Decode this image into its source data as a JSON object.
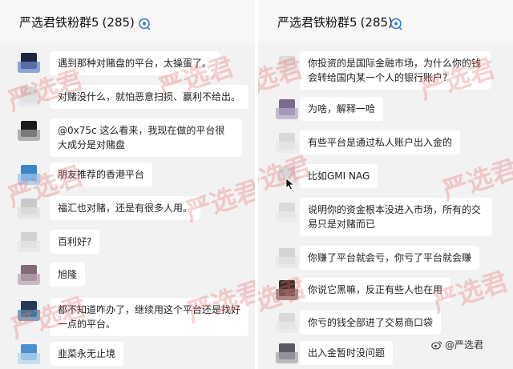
{
  "left": {
    "title": "严选君铁粉群5",
    "count": "(285)",
    "messages": [
      {
        "text": "遇到那种对赌盘的平台，太操蛋了。",
        "avatar": [
          "#1b2540",
          "#6b86c8"
        ]
      },
      {
        "text": "对赌没什么，就怕恶意扫损、赢利不给出。",
        "avatar": [
          "#d6d6d6",
          "#e4e4e4"
        ]
      },
      {
        "text": "@0x75c 这么看来，我现在做的平台很大成分是对赌盘",
        "avatar": [
          "#1c1c1c",
          "#9a9a9a"
        ]
      },
      {
        "text": "朋友推荐的香港平台",
        "avatar": [
          "#3d84c6",
          "#9cc6ea"
        ]
      },
      {
        "text": "福汇也对赌，还是有很多人用。",
        "avatar": [
          "#c9c9c9",
          "#e0e0e0"
        ]
      },
      {
        "text": "百利好?",
        "avatar": [
          "#d2d2d2",
          "#e6e6e6"
        ]
      },
      {
        "text": "旭隆",
        "avatar": [
          "#806a78",
          "#b9a7b2"
        ]
      },
      {
        "text": "都不知道咋办了，继续用这个平台还是找好一点的平台。",
        "avatar": [
          "#263a55",
          "#4f8bb0"
        ]
      },
      {
        "text": "韭菜永无止境",
        "avatar": [
          "#4a8fcf",
          "#b8d6ef"
        ]
      }
    ]
  },
  "right": {
    "title": "严选君铁粉群5",
    "count": "(285)",
    "messages": [
      {
        "text": "你投资的是国际金融市场，为什么你的钱会转给国内某一个人的银行账户?",
        "avatar": [
          "#dcdcdc",
          "#ebebeb"
        ]
      },
      {
        "text": "为啥，解释一哈",
        "avatar": [
          "#7a6b8f",
          "#b3a8c4"
        ]
      },
      {
        "text": "有些平台是通过私人账户出入金的",
        "avatar": [
          "#d8d8d8",
          "#e8e8e8"
        ]
      },
      {
        "text": "比如GMI NAG",
        "avatar": [
          "#d6d6d6",
          "#e6e6e6"
        ]
      },
      {
        "text": "说明你的资金根本没进入市场，所有的交易只是对赌而已",
        "avatar": [
          "#dadada",
          "#e9e9e9"
        ]
      },
      {
        "text": "你赚了平台就会亏，你亏了平台就会赚",
        "avatar": [
          "#d4d4d4",
          "#e5e5e5"
        ]
      },
      {
        "text": "你说它黑嘛，反正有些人也在用",
        "avatar": [
          "#3a2a2a",
          "#8a6a66"
        ]
      },
      {
        "text": "你亏的钱全部进了交易商口袋",
        "avatar": [
          "#d9d9d9",
          "#e8e8e8"
        ]
      },
      {
        "text": "出入金暂时没问题",
        "avatar": [
          "#5a5a62",
          "#a6a6ae"
        ]
      }
    ]
  },
  "watermark_text": "严选君",
  "footer_watermark": "@严选君",
  "colors": {
    "chat_background": "#f2f2f2",
    "bubble": "#ffffff",
    "group_icon": "#3a7bd5",
    "watermark": "#e86e6e"
  },
  "icons": {
    "group_icon": "group-chat-icon",
    "cursor": "mouse-pointer-icon",
    "footer_logo": "weibo-logo-icon"
  }
}
